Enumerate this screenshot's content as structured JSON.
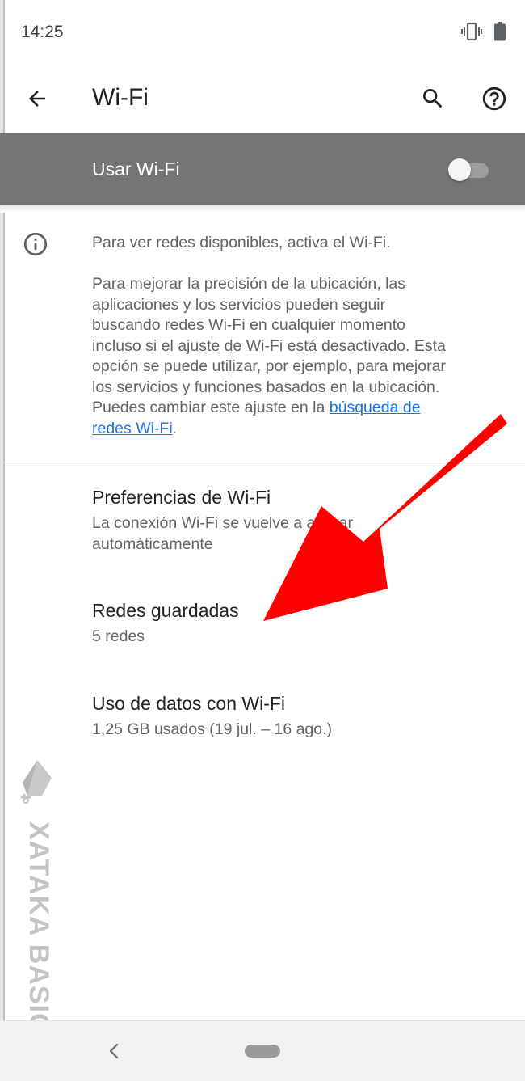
{
  "status_bar": {
    "time": "14:25",
    "icons": [
      "vibrate-icon",
      "battery-icon"
    ]
  },
  "app_bar": {
    "title": "Wi-Fi",
    "icons": [
      "back-arrow-icon",
      "search-icon",
      "help-icon"
    ]
  },
  "master_switch": {
    "label": "Usar Wi-Fi",
    "enabled": false
  },
  "info": {
    "line1": "Para ver redes disponibles, activa el Wi-Fi.",
    "para_lines": [
      "Para mejorar la precisión de la ubicación, las",
      "aplicaciones y los servicios pueden seguir",
      "buscando redes Wi-Fi en cualquier momento",
      "incluso si el ajuste de Wi-Fi está desactivado. Esta",
      "opción se puede utilizar, por ejemplo, para mejorar",
      "los servicios y funciones basados en la ubicación."
    ],
    "para_last_prefix": "Puedes cambiar este ajuste en la ",
    "link_part1": "búsqueda de",
    "link_part2": "redes Wi-Fi",
    "link_suffix": "."
  },
  "items": [
    {
      "title": "Preferencias de Wi-Fi",
      "summary_lines": [
        "La conexión Wi-Fi se vuelve a activar",
        "automáticamente"
      ]
    },
    {
      "title": "Redes guardadas",
      "summary_lines": [
        "5 redes"
      ]
    },
    {
      "title": "Uso de datos con Wi-Fi",
      "summary_lines": [
        "1,25 GB usados (19 jul. – 16 ago.)"
      ]
    }
  ],
  "watermark": {
    "text": "XATAKA BASICS"
  },
  "annotation": {
    "arrow_color": "#ff0000"
  },
  "nav_bar": {
    "icons": [
      "nav-back-icon",
      "home-pill"
    ]
  }
}
